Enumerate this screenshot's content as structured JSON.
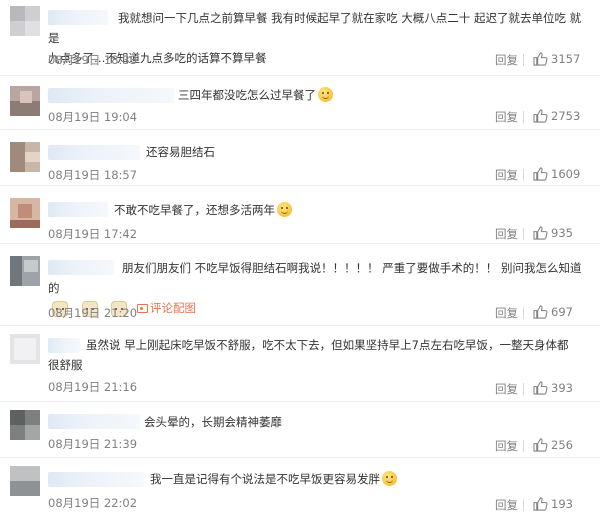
{
  "comments": [
    {
      "text_lines": [
        "我就想问一下几点之前算早餐 我有时候起早了就在家吃 大概八点二十 起迟了就去单位吃 就是",
        "九点多了…不知道九点多吃的话算不算早餐"
      ],
      "time": "08月19日 18:33",
      "reply": "回复",
      "likes": "3157"
    },
    {
      "text": "三四年都没吃怎么过早餐了",
      "time": "08月19日 19:04",
      "reply": "回复",
      "likes": "2753"
    },
    {
      "text": "还容易胆结石",
      "time": "08月19日 18:57",
      "reply": "回复",
      "likes": "1609"
    },
    {
      "text": "不敢不吃早餐了，还想多活两年",
      "time": "08月19日 17:42",
      "reply": "回复",
      "likes": "935"
    },
    {
      "text": "朋友们朋友们 不吃早饭得胆结石啊我说！！！！！ 严重了要做手术的！！ 别问我怎么知道的",
      "pic_link": "评论配图",
      "time": "08月19日 21:20",
      "reply": "回复",
      "likes": "697"
    },
    {
      "text_lines": [
        "虽然说 早上刚起床吃早饭不舒服，吃不太下去，但如果坚持早上7点左右吃早饭，一整天身体都",
        "很舒服"
      ],
      "time": "08月19日 21:16",
      "reply": "回复",
      "likes": "393"
    },
    {
      "text": "会头晕的，长期会精神萎靡",
      "time": "08月19日 21:39",
      "reply": "回复",
      "likes": "256"
    },
    {
      "text": "我一直是记得有个说法是不吃早饭更容易发胖",
      "time": "08月19日 22:02",
      "reply": "回复",
      "likes": "193"
    }
  ],
  "colors": {
    "link": "#eb7350",
    "meta": "#808080",
    "text": "#333333",
    "divider": "#ececec"
  },
  "icons": {
    "like": "thumbs-up-icon",
    "emoji": "smile-emoji-icon",
    "picture": "picture-icon"
  }
}
